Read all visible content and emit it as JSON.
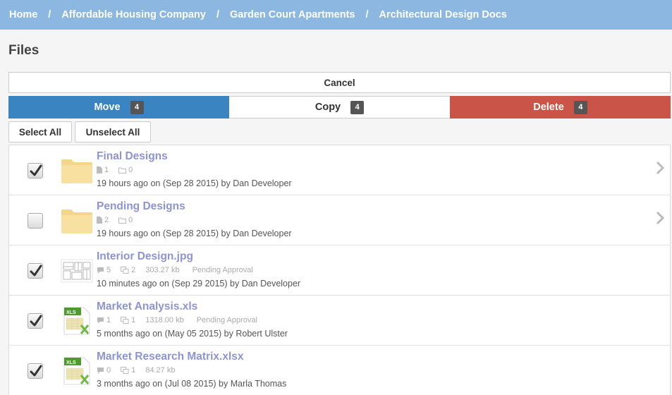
{
  "breadcrumb": [
    "Home",
    "Affordable Housing Company",
    "Garden Court Apartments",
    "Architectural Design Docs"
  ],
  "breadcrumb_separator": "/",
  "page_title": "Files",
  "cancel_label": "Cancel",
  "actions": {
    "move": {
      "label": "Move",
      "count": "4"
    },
    "copy": {
      "label": "Copy",
      "count": "4"
    },
    "delete": {
      "label": "Delete",
      "count": "4"
    }
  },
  "select_all_label": "Select All",
  "unselect_all_label": "Unselect All",
  "colors": {
    "breadcrumb_bg": "#8cb7e0",
    "move": "#3a84c2",
    "delete": "#c95447",
    "link": "#8d94d6"
  },
  "files": [
    {
      "name": "Final Designs",
      "type": "folder",
      "checked": true,
      "files_count": "1",
      "folders_count": "0",
      "date": "19 hours ago on (Sep 28 2015) by Dan Developer"
    },
    {
      "name": "Pending Designs",
      "type": "folder",
      "checked": false,
      "files_count": "2",
      "folders_count": "0",
      "date": "19 hours ago on (Sep 28 2015) by Dan Developer"
    },
    {
      "name": "Interior Design.jpg",
      "type": "image",
      "checked": true,
      "comments": "5",
      "versions": "2",
      "size": "303.27 kb",
      "status": "Pending Approval",
      "date": "10 minutes ago on (Sep 29 2015) by Dan Developer"
    },
    {
      "name": "Market Analysis.xls",
      "type": "xls",
      "checked": true,
      "comments": "1",
      "versions": "1",
      "size": "1318.00 kb",
      "status": "Pending Approval",
      "date": "5 months ago on (May 05 2015) by Robert Ulster"
    },
    {
      "name": "Market Research Matrix.xlsx",
      "type": "xls",
      "checked": true,
      "comments": "0",
      "versions": "1",
      "size": "84.27 kb",
      "status": "",
      "date": "3 months ago on (Jul 08 2015) by Marla Thomas"
    }
  ]
}
